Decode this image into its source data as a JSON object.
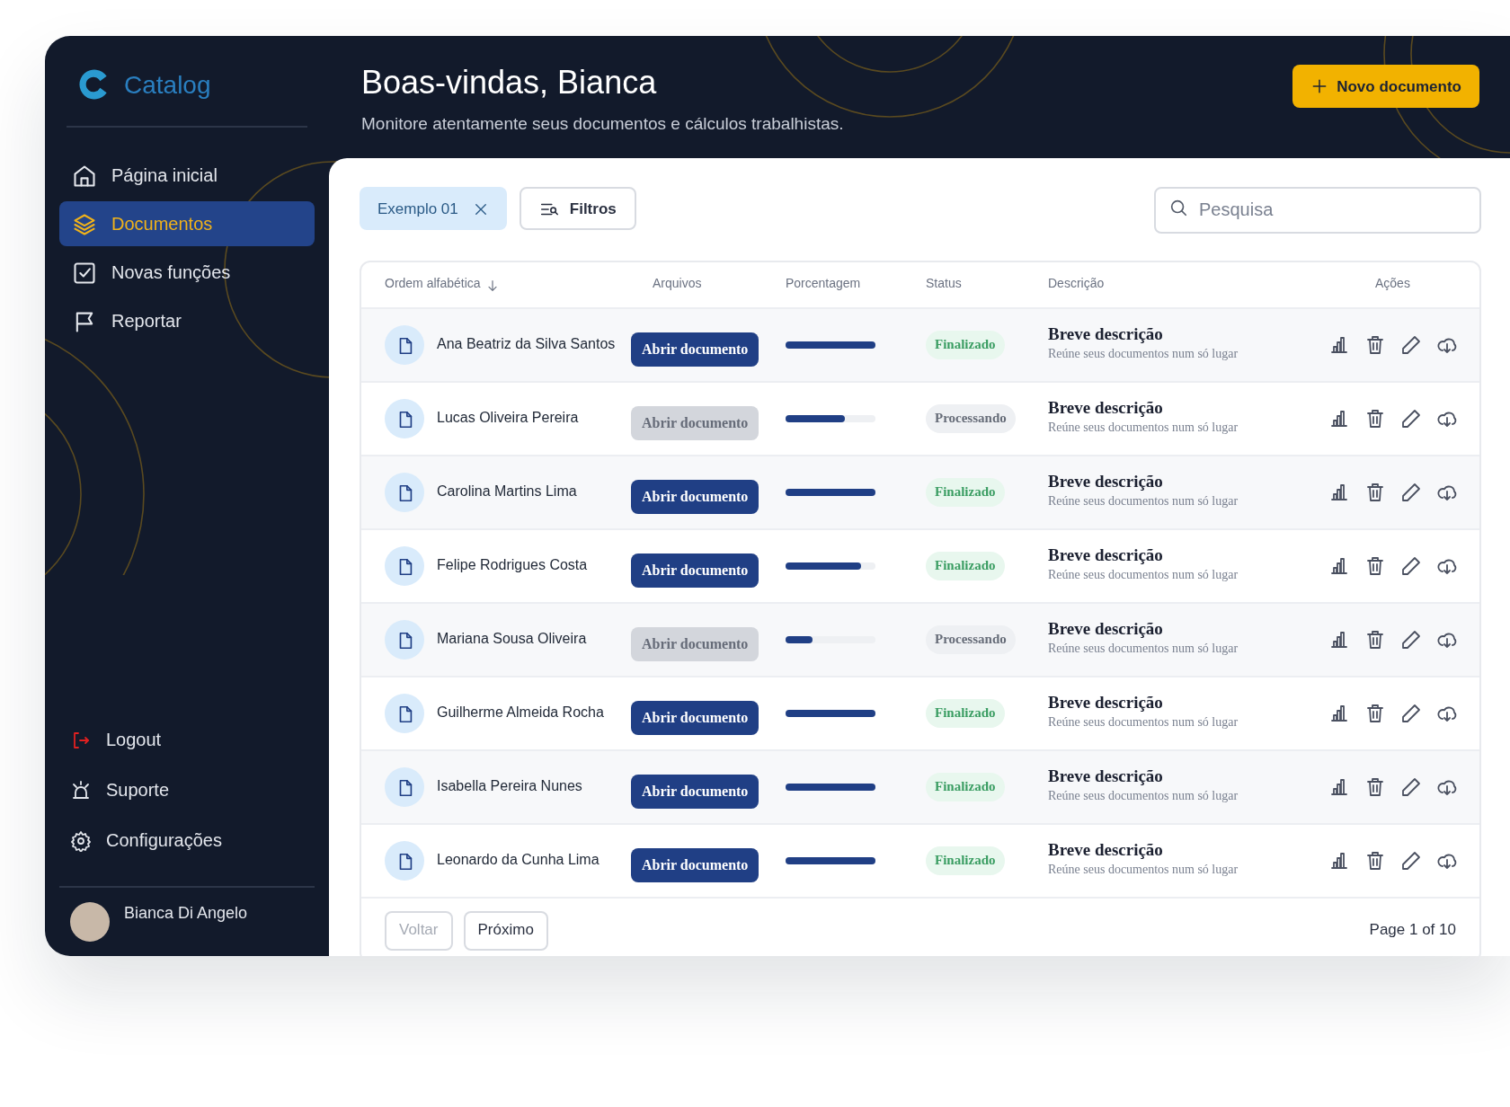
{
  "sidebar": {
    "brand": "Catalog",
    "items": [
      {
        "label": "Página inicial",
        "selected": false
      },
      {
        "label": "Documentos",
        "selected": true
      },
      {
        "label": "Novas funções",
        "selected": false
      },
      {
        "label": "Reportar",
        "selected": false
      }
    ],
    "bottom_items": [
      {
        "label": "Logout"
      },
      {
        "label": "Suporte"
      },
      {
        "label": "Configurações"
      }
    ],
    "user": {
      "name": "Bianca Di Angelo"
    }
  },
  "header": {
    "title": "Boas-vindas, Bianca",
    "subtitle": "Monitore atentamente seus documentos e cálculos trabalhistas.",
    "action": "Novo documento"
  },
  "toolbar": {
    "filter_chip": "Exemplo 01",
    "filter_button": "Filtros",
    "search": {
      "placeholder": "Pesquisa"
    }
  },
  "table": {
    "columns": [
      "Ordem alfabética",
      "Arquivos",
      "Porcentagem",
      "Status",
      "Descrição",
      "Ações"
    ],
    "rows": [
      {
        "name": "Ana Beatriz da Silva Santos",
        "file_button": "Abrir documento",
        "disabled": false,
        "level": 1.0,
        "status": "Finalizado",
        "finished": true,
        "title": "Breve descrição",
        "text": "Reúne seus documentos num só lugar"
      },
      {
        "name": "Lucas Oliveira Pereira",
        "file_button": "Abrir documento",
        "disabled": true,
        "level": 0.66,
        "status": "Processando",
        "finished": false,
        "title": "Breve descrição",
        "text": "Reúne seus documentos num só lugar"
      },
      {
        "name": "Carolina Martins Lima",
        "file_button": "Abrir documento",
        "disabled": false,
        "level": 1.0,
        "status": "Finalizado",
        "finished": true,
        "title": "Breve descrição",
        "text": "Reúne seus documentos num só lugar"
      },
      {
        "name": "Felipe Rodrigues Costa",
        "file_button": "Abrir documento",
        "disabled": false,
        "level": 0.84,
        "status": "Finalizado",
        "finished": true,
        "title": "Breve descrição",
        "text": "Reúne seus documentos num só lugar"
      },
      {
        "name": "Mariana Sousa Oliveira",
        "file_button": "Abrir documento",
        "disabled": true,
        "level": 0.3,
        "status": "Processando",
        "finished": false,
        "title": "Breve descrição",
        "text": "Reúne seus documentos num só lugar"
      },
      {
        "name": "Guilherme Almeida Rocha",
        "file_button": "Abrir documento",
        "disabled": false,
        "level": 1.0,
        "status": "Finalizado",
        "finished": true,
        "title": "Breve descrição",
        "text": "Reúne seus documentos num só lugar"
      },
      {
        "name": "Isabella Pereira Nunes",
        "file_button": "Abrir documento",
        "disabled": false,
        "level": 1.0,
        "status": "Finalizado",
        "finished": true,
        "title": "Breve descrição",
        "text": "Reúne seus documentos num só lugar"
      },
      {
        "name": "Leonardo da Cunha Lima",
        "file_button": "Abrir documento",
        "disabled": false,
        "level": 1.0,
        "status": "Finalizado",
        "finished": true,
        "title": "Breve descrição",
        "text": "Reúne seus documentos num só lugar"
      }
    ]
  },
  "pagination": {
    "prev": {
      "label": "Voltar",
      "disabled": true
    },
    "next": {
      "label": "Próximo",
      "disabled": false
    },
    "page": "Page 1 of 10"
  }
}
